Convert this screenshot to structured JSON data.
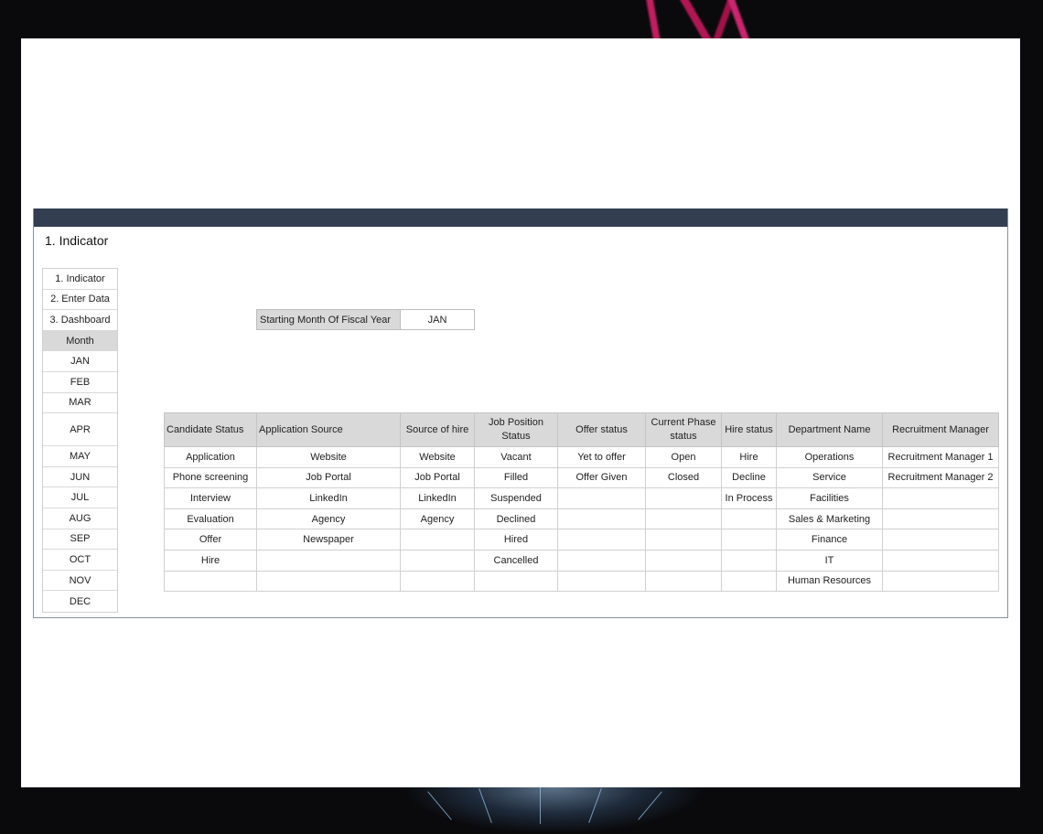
{
  "sheet": {
    "title": "1. Indicator"
  },
  "nav": {
    "items": [
      "1. Indicator",
      "2. Enter Data",
      "3. Dashboard"
    ],
    "month_header": "Month",
    "months": [
      "JAN",
      "FEB",
      "MAR",
      "APR",
      "MAY",
      "JUN",
      "JUL",
      "AUG",
      "SEP",
      "OCT",
      "NOV",
      "DEC"
    ]
  },
  "fiscal": {
    "label": "Starting Month Of Fiscal Year",
    "value": "JAN"
  },
  "indicator_table": {
    "headers": [
      "Candidate Status",
      "Application Source",
      "Source of hire",
      "Job Position Status",
      "Offer status",
      "Current Phase status",
      "Hire status",
      "Department Name",
      "Recruitment Manager"
    ],
    "rows": [
      [
        "Application",
        "Website",
        "Website",
        "Vacant",
        "Yet to offer",
        "Open",
        "Hire",
        "Operations",
        "Recruitment Manager 1"
      ],
      [
        "Phone screening",
        "Job Portal",
        "Job Portal",
        "Filled",
        "Offer Given",
        "Closed",
        "Decline",
        "Service",
        "Recruitment Manager 2"
      ],
      [
        "Interview",
        "LinkedIn",
        "LinkedIn",
        "Suspended",
        "",
        "",
        "In Process",
        "Facilities",
        ""
      ],
      [
        "Evaluation",
        "Agency",
        "Agency",
        "Declined",
        "",
        "",
        "",
        "Sales & Marketing",
        ""
      ],
      [
        "Offer",
        "Newspaper",
        "",
        "Hired",
        "",
        "",
        "",
        "Finance",
        ""
      ],
      [
        "Hire",
        "",
        "",
        "Cancelled",
        "",
        "",
        "",
        "IT",
        ""
      ],
      [
        "",
        "",
        "",
        "",
        "",
        "",
        "",
        "Human Resources",
        ""
      ]
    ]
  },
  "colors": {
    "header_bar": "#333f50",
    "header_cell": "#d9d9d9",
    "background": "#0a0a0c"
  }
}
